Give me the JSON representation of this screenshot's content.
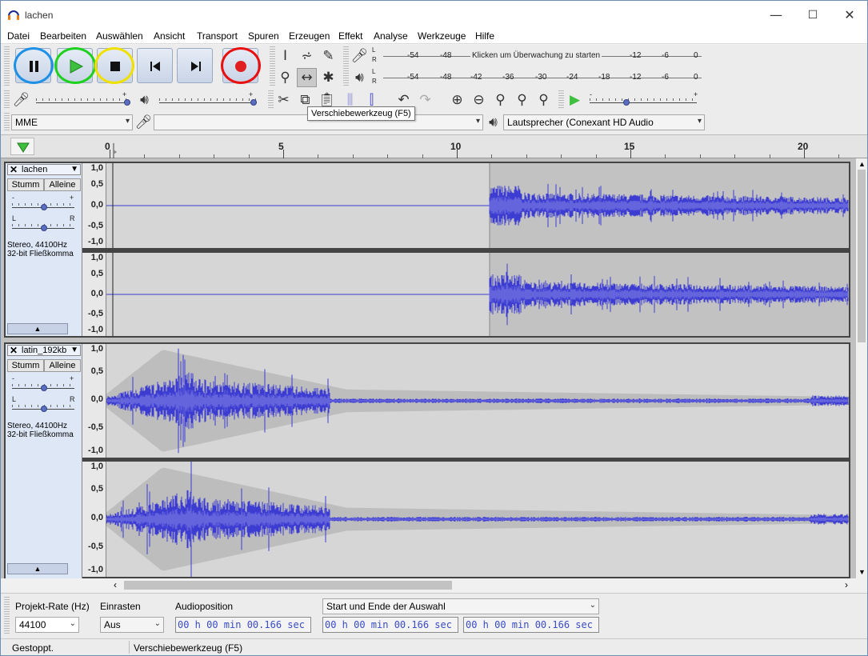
{
  "window": {
    "title": "lachen",
    "minimize": "—",
    "maximize": "☐",
    "close": "✕"
  },
  "menu": [
    "Datei",
    "Bearbeiten",
    "Auswählen",
    "Ansicht",
    "Transport",
    "Spuren",
    "Erzeugen",
    "Effekt",
    "Analyse",
    "Werkzeuge",
    "Hilfe"
  ],
  "transport": {
    "buttons": [
      {
        "name": "pause",
        "icon": "pause-icon",
        "ring": "#1e90e6"
      },
      {
        "name": "play",
        "icon": "play-icon",
        "ring": "#1ed11e"
      },
      {
        "name": "stop",
        "icon": "stop-icon",
        "ring": "#f0e000"
      },
      {
        "name": "skip-start",
        "icon": "skip-start-icon",
        "ring": ""
      },
      {
        "name": "skip-end",
        "icon": "skip-end-icon",
        "ring": ""
      },
      {
        "name": "record",
        "icon": "record-icon",
        "ring": "#e81010"
      }
    ]
  },
  "meters": {
    "record_ticks": [
      "-54",
      "-48",
      "-12",
      "-6",
      "0"
    ],
    "record_hint": "Klicken um Überwachung zu starten",
    "play_ticks": [
      "-54",
      "-48",
      "-42",
      "-36",
      "-30",
      "-24",
      "-18",
      "-12",
      "-6",
      "0"
    ],
    "channel_l": "L",
    "channel_r": "R"
  },
  "sliders": {
    "minus": "-",
    "plus": "+"
  },
  "devices": {
    "host": "MME",
    "input": "",
    "output": "Lautsprecher (Conexant HD Audio"
  },
  "tooltip": "Verschiebewerkzeug (F5)",
  "timeline": {
    "labels": [
      "0",
      "5",
      "10",
      "15",
      "20"
    ]
  },
  "tracks": [
    {
      "name": "lachen",
      "mute": "Stumm",
      "solo": "Alleine",
      "gain_minus": "-",
      "gain_plus": "+",
      "pan_l": "L",
      "pan_r": "R",
      "info1": "Stereo, 44100Hz",
      "info2": "32-bit Fließkomma",
      "scale": [
        "1,0",
        "0,5",
        "0,0",
        "-0,5",
        "-1,0"
      ]
    },
    {
      "name": "latin_192kb",
      "mute": "Stumm",
      "solo": "Alleine",
      "gain_minus": "-",
      "gain_plus": "+",
      "pan_l": "L",
      "pan_r": "R",
      "info1": "Stereo, 44100Hz",
      "info2": "32-bit Fließkomma",
      "scale": [
        "1,0",
        "0,5",
        "0,0",
        "-0,5",
        "-1,0"
      ]
    }
  ],
  "selection": {
    "rate_label": "Projekt-Rate (Hz)",
    "rate_value": "44100",
    "snap_label": "Einrasten",
    "snap_value": "Aus",
    "position_label": "Audioposition",
    "position_value": "00 h 00 min 00.166 sec",
    "range_label": "Start und Ende der Auswahl",
    "start_value": "00 h 00 min 00.166 sec",
    "end_value": "00 h 00 min 00.166 sec"
  },
  "status": {
    "left": "Gestoppt.",
    "right": "Verschiebewerkzeug (F5)"
  },
  "colors": {
    "waveform": "#3c3cd2",
    "waveform_rms": "#6464dc",
    "envelope": "#bdbdbd",
    "accent": "#5a6fbf"
  }
}
